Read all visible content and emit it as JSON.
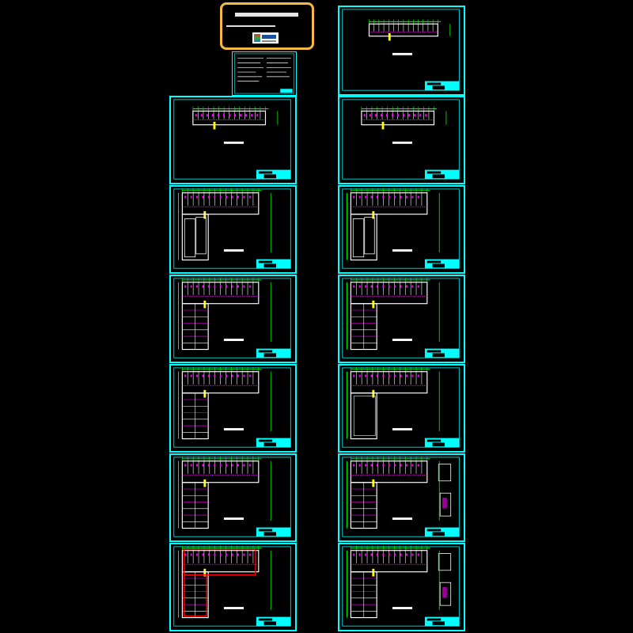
{
  "colors": {
    "background": "#000000",
    "frame": "#00ffff",
    "wall": "#ffffff",
    "axis": "#00ff00",
    "furniture": "#ff00ff",
    "highlight": "#ffff00",
    "markup": "#ff0000",
    "banner_border": "#f5b942"
  },
  "banner": {
    "logo_icon": "site-logo-icon"
  },
  "sheets": [
    {
      "variant": "top-floor"
    },
    {
      "variant": "strip"
    },
    {
      "variant": "strip"
    },
    {
      "variant": "L"
    },
    {
      "variant": "L"
    },
    {
      "variant": "L-grid"
    },
    {
      "variant": "L-grid"
    },
    {
      "variant": "L-grid"
    },
    {
      "variant": "L-open"
    },
    {
      "variant": "L-grid"
    },
    {
      "variant": "L-details"
    },
    {
      "variant": "L-redline"
    },
    {
      "variant": "L-details"
    }
  ]
}
